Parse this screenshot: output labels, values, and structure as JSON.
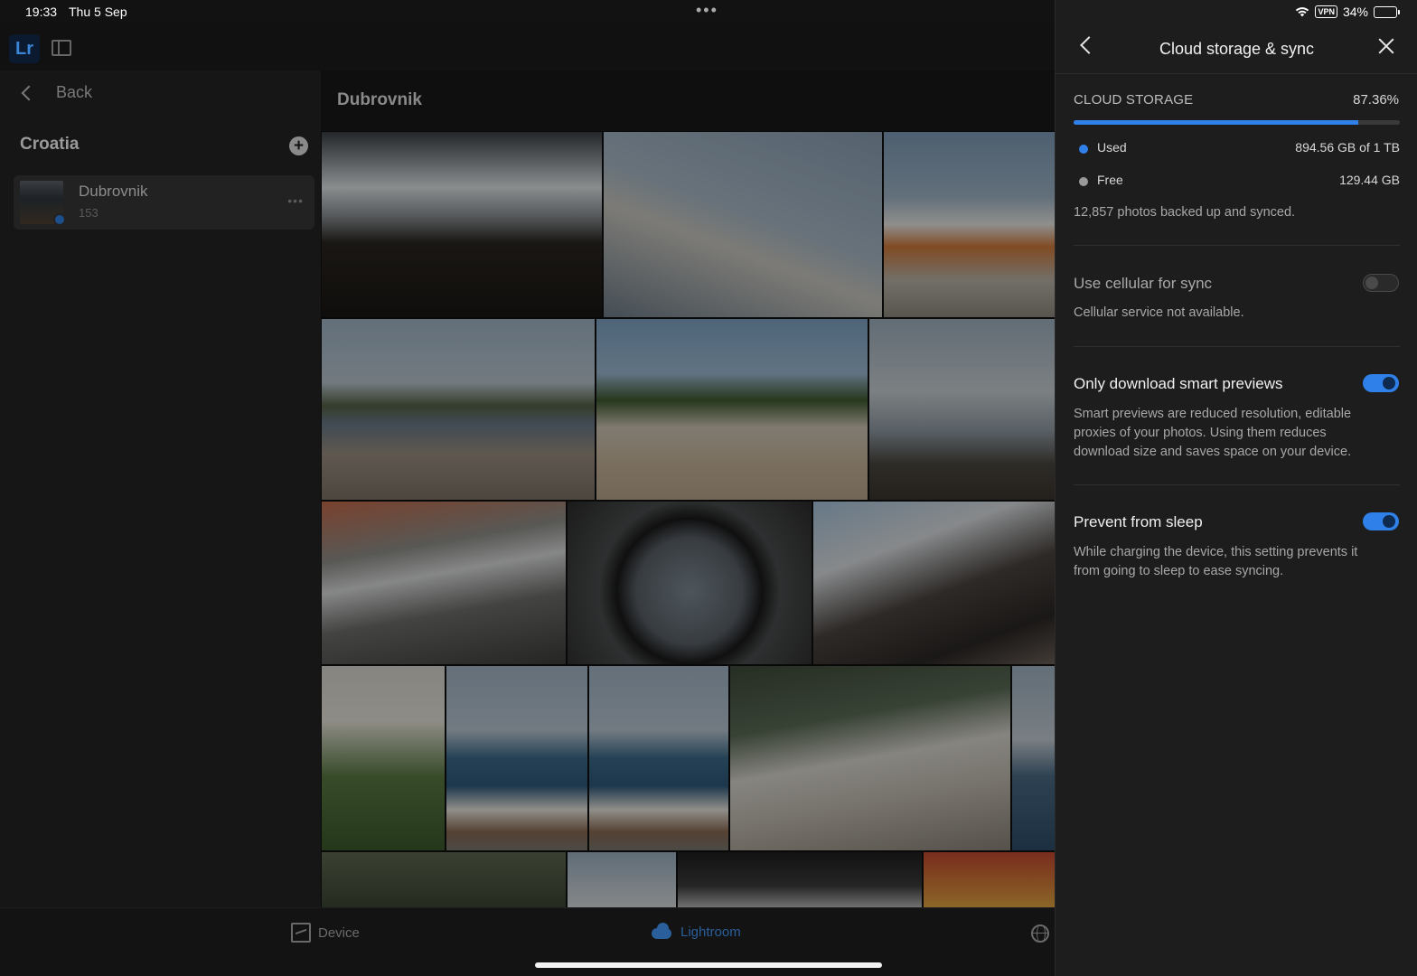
{
  "status_bar": {
    "time": "19:33",
    "date": "Thu 5 Sep",
    "vpn": "VPN",
    "battery_percent": "34%",
    "battery_level": 0.34
  },
  "app": {
    "logo_text": "Lr"
  },
  "sidebar": {
    "back_label": "Back",
    "group_title": "Croatia",
    "album": {
      "name": "Dubrovnik",
      "count": "153"
    }
  },
  "main": {
    "album_title": "Dubrovnik"
  },
  "bottom_tabs": {
    "device_label": "Device",
    "lightroom_label": "Lightroom",
    "active": "Lightroom"
  },
  "panel": {
    "title": "Cloud storage & sync",
    "cloud_storage": {
      "label": "CLOUD STORAGE",
      "percent_text": "87.36%",
      "used_fraction": 0.8736,
      "used_label": "Used",
      "used_value": "894.56 GB of 1 TB",
      "free_label": "Free",
      "free_value": "129.44 GB",
      "sync_note": "12,857 photos backed up and synced."
    },
    "settings": [
      {
        "title": "Use cellular for sync",
        "description": "Cellular service not available.",
        "enabled": false,
        "available": false
      },
      {
        "title": "Only download smart previews",
        "description": "Smart previews are reduced resolution, editable proxies of your photos. Using them reduces download size and saves space on your device.",
        "enabled": true,
        "available": true
      },
      {
        "title": "Prevent from sleep",
        "description": "While charging the device, this setting prevents it from going to sleep to ease syncing.",
        "enabled": true,
        "available": true
      }
    ]
  },
  "colors": {
    "accent": "#2f80e8",
    "used_dot": "#2f80e8",
    "free_dot": "#9a9a9a",
    "panel_bg": "#1d1d1d"
  }
}
